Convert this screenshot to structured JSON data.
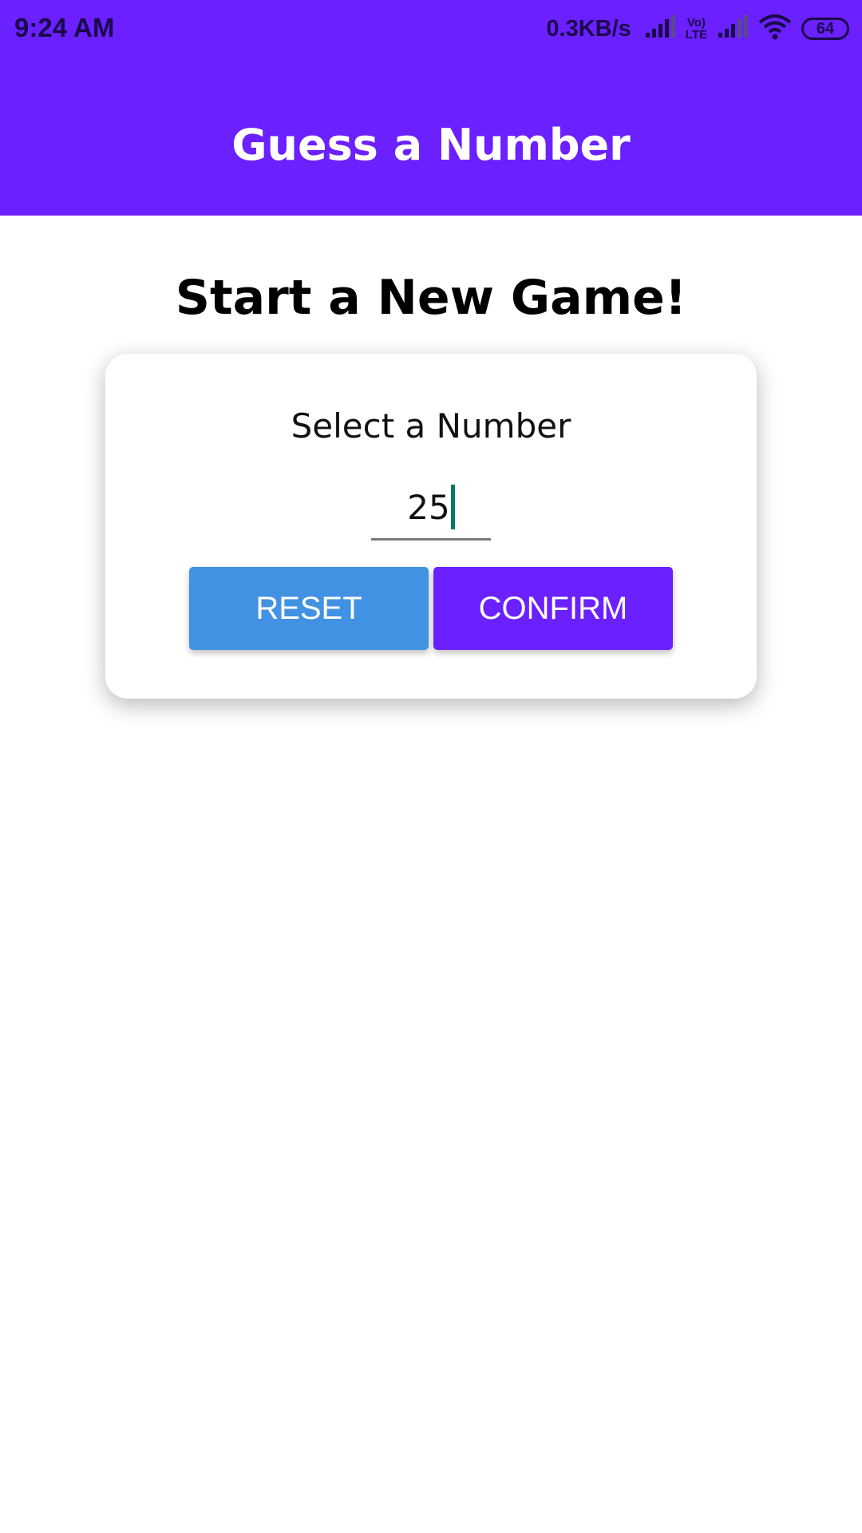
{
  "status_bar": {
    "time": "9:24 AM",
    "net_speed": "0.3KB/s",
    "volte_line1": "Vo)",
    "volte_line2": "LTE",
    "battery": "64",
    "icons": [
      "signal-icon",
      "volte-icon",
      "signal-icon",
      "wifi-icon",
      "battery-icon"
    ]
  },
  "header": {
    "title": "Guess a Number",
    "color": "#6a20ff"
  },
  "main": {
    "heading": "Start a New Game!",
    "card": {
      "label": "Select a Number",
      "input_value": "25",
      "reset_label": "RESET",
      "confirm_label": "CONFIRM",
      "reset_color": "#4192e2",
      "confirm_color": "#6a20ff"
    }
  }
}
